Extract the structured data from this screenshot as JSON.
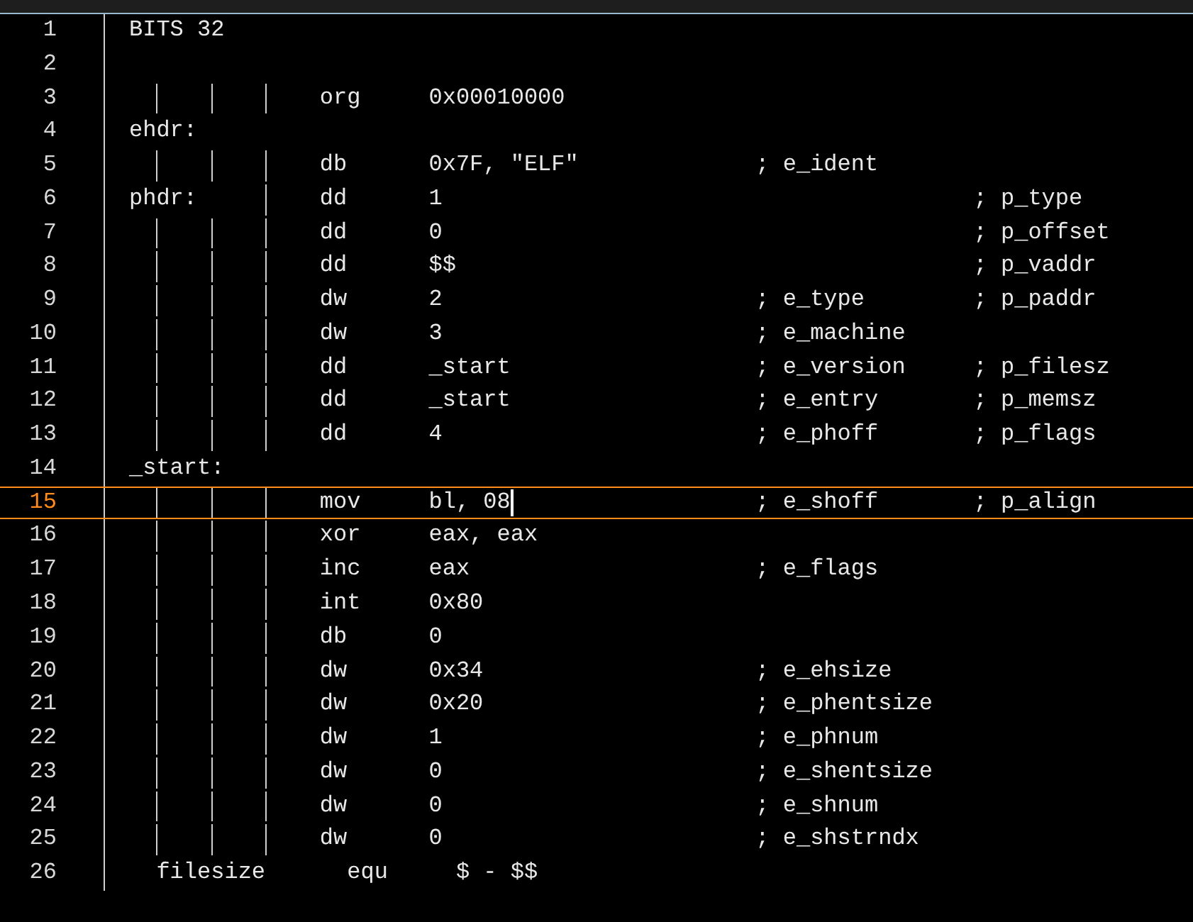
{
  "lines": [
    {
      "number": "1",
      "kind": "directive",
      "text": "BITS 32",
      "current": false
    },
    {
      "number": "2",
      "kind": "blank",
      "current": false
    },
    {
      "number": "3",
      "kind": "instr",
      "op": "org",
      "args": "0x00010000",
      "current": false
    },
    {
      "number": "4",
      "kind": "label",
      "label": "ehdr:",
      "current": false
    },
    {
      "number": "5",
      "kind": "instr",
      "op": "db",
      "args": "0x7F, \"ELF\"",
      "comment": "; e_ident",
      "current": false
    },
    {
      "number": "6",
      "kind": "instr",
      "label": "phdr:",
      "op": "dd",
      "args": "1",
      "comment2": "; p_type",
      "current": false
    },
    {
      "number": "7",
      "kind": "instr",
      "op": "dd",
      "args": "0",
      "comment2": "; p_offset",
      "current": false
    },
    {
      "number": "8",
      "kind": "instr",
      "op": "dd",
      "args": "$$",
      "comment2": "; p_vaddr",
      "current": false
    },
    {
      "number": "9",
      "kind": "instr",
      "op": "dw",
      "args": "2",
      "comment": "; e_type",
      "comment2": "; p_paddr",
      "current": false
    },
    {
      "number": "10",
      "kind": "instr",
      "op": "dw",
      "args": "3",
      "comment": "; e_machine",
      "current": false
    },
    {
      "number": "11",
      "kind": "instr",
      "op": "dd",
      "args": "_start",
      "comment": "; e_version",
      "comment2": "; p_filesz",
      "current": false
    },
    {
      "number": "12",
      "kind": "instr",
      "op": "dd",
      "args": "_start",
      "comment": "; e_entry",
      "comment2": "; p_memsz",
      "current": false
    },
    {
      "number": "13",
      "kind": "instr",
      "op": "dd",
      "args": "4",
      "comment": "; e_phoff",
      "comment2": "; p_flags",
      "current": false
    },
    {
      "number": "14",
      "kind": "label",
      "label": "_start:",
      "current": false
    },
    {
      "number": "15",
      "kind": "instr",
      "op": "mov",
      "args": "bl, 08",
      "comment": "; e_shoff",
      "comment2": "; p_align",
      "current": true
    },
    {
      "number": "16",
      "kind": "instr",
      "op": "xor",
      "args": "eax, eax",
      "current": false
    },
    {
      "number": "17",
      "kind": "instr",
      "op": "inc",
      "args": "eax",
      "comment": "; e_flags",
      "current": false
    },
    {
      "number": "18",
      "kind": "instr",
      "op": "int",
      "args": "0x80",
      "current": false
    },
    {
      "number": "19",
      "kind": "instr",
      "op": "db",
      "args": "0",
      "current": false
    },
    {
      "number": "20",
      "kind": "instr",
      "op": "dw",
      "args": "0x34",
      "comment": "; e_ehsize",
      "current": false
    },
    {
      "number": "21",
      "kind": "instr",
      "op": "dw",
      "args": "0x20",
      "comment": "; e_phentsize",
      "current": false
    },
    {
      "number": "22",
      "kind": "instr",
      "op": "dw",
      "args": "1",
      "comment": "; e_phnum",
      "current": false
    },
    {
      "number": "23",
      "kind": "instr",
      "op": "dw",
      "args": "0",
      "comment": "; e_shentsize",
      "current": false
    },
    {
      "number": "24",
      "kind": "instr",
      "op": "dw",
      "args": "0",
      "comment": "; e_shnum",
      "current": false
    },
    {
      "number": "25",
      "kind": "instr",
      "op": "dw",
      "args": "0",
      "comment": "; e_shstrndx",
      "current": false
    },
    {
      "number": "26",
      "kind": "equ",
      "label": "filesize",
      "op": "equ",
      "args": "$ - $$",
      "current": false
    }
  ]
}
